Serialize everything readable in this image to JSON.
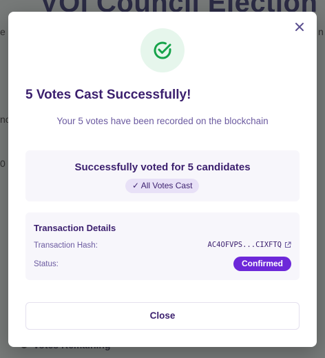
{
  "background": {
    "title_fragment": "VOI Council Election",
    "left_fragments": [
      "e",
      "nc",
      "0"
    ],
    "right_fragment": "n",
    "bottom_text": "Votes Remaining"
  },
  "modal": {
    "close_icon": "close-icon",
    "success_icon": "check-circle-icon",
    "title": "5 Votes Cast Successfully!",
    "subtitle": "Your 5 votes have been recorded on the blockchain",
    "summary": {
      "text": "Successfully voted for 5 candidates",
      "badge": "✓ All Votes Cast"
    },
    "transaction": {
      "heading": "Transaction Details",
      "hash_label": "Transaction Hash:",
      "hash_value": "AC4OFVPS...CIXFTQ",
      "status_label": "Status:",
      "status_value": "Confirmed"
    },
    "close_button": "Close"
  },
  "colors": {
    "accent": "#6d28d9",
    "title": "#3b1f6e",
    "success": "#16a34a",
    "success_bg": "#e6f6ec"
  }
}
